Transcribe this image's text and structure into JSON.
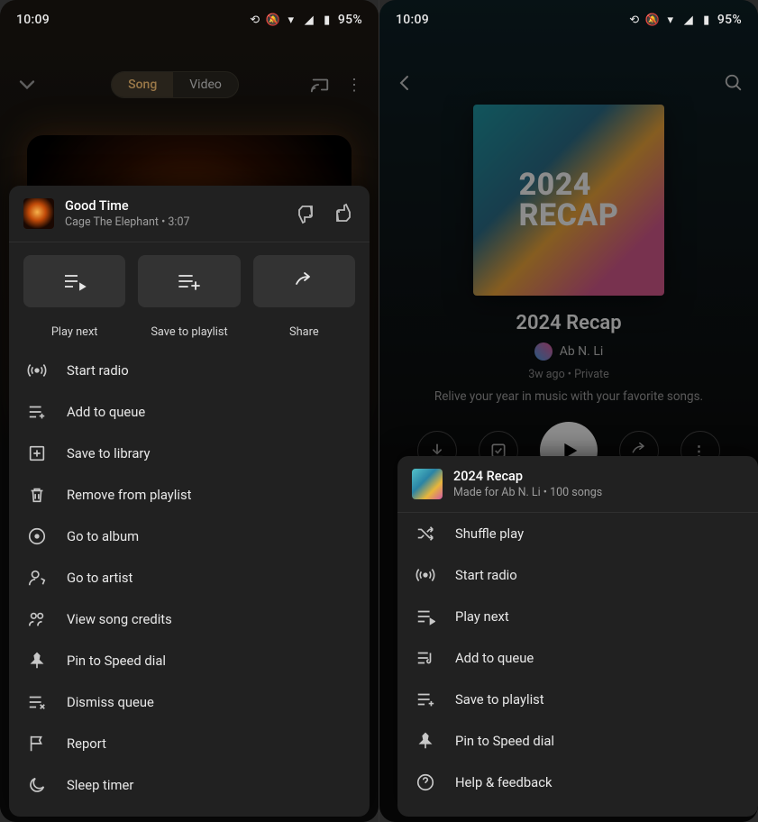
{
  "statusbar": {
    "time": "10:09",
    "battery_pct": "95%"
  },
  "left": {
    "seg": {
      "song": "Song",
      "video": "Video"
    },
    "track": {
      "title": "Good Time",
      "subtitle": "Cage The Elephant • 3:07"
    },
    "actions": {
      "play_next": "Play next",
      "save_playlist": "Save to playlist",
      "share": "Share"
    },
    "menu": {
      "start_radio": "Start radio",
      "add_queue": "Add to queue",
      "save_library": "Save to library",
      "remove_playlist": "Remove from playlist",
      "go_album": "Go to album",
      "go_artist": "Go to artist",
      "credits": "View song credits",
      "pin_speed": "Pin to Speed dial",
      "dismiss_queue": "Dismiss queue",
      "report": "Report",
      "sleep_timer": "Sleep timer"
    }
  },
  "right": {
    "cover_text_line1": "2024",
    "cover_text_line2": "RECAP",
    "playlist_title": "2024 Recap",
    "owner": "Ab N. Li",
    "meta": "3w ago • Private",
    "description": "Relive your year in music with your favorite songs.",
    "sheet": {
      "title": "2024 Recap",
      "subtitle": "Made for Ab N. Li • 100 songs",
      "menu": {
        "shuffle": "Shuffle play",
        "start_radio": "Start radio",
        "play_next": "Play next",
        "add_queue": "Add to queue",
        "save_playlist": "Save to playlist",
        "pin_speed": "Pin to Speed dial",
        "help": "Help & feedback"
      }
    }
  }
}
